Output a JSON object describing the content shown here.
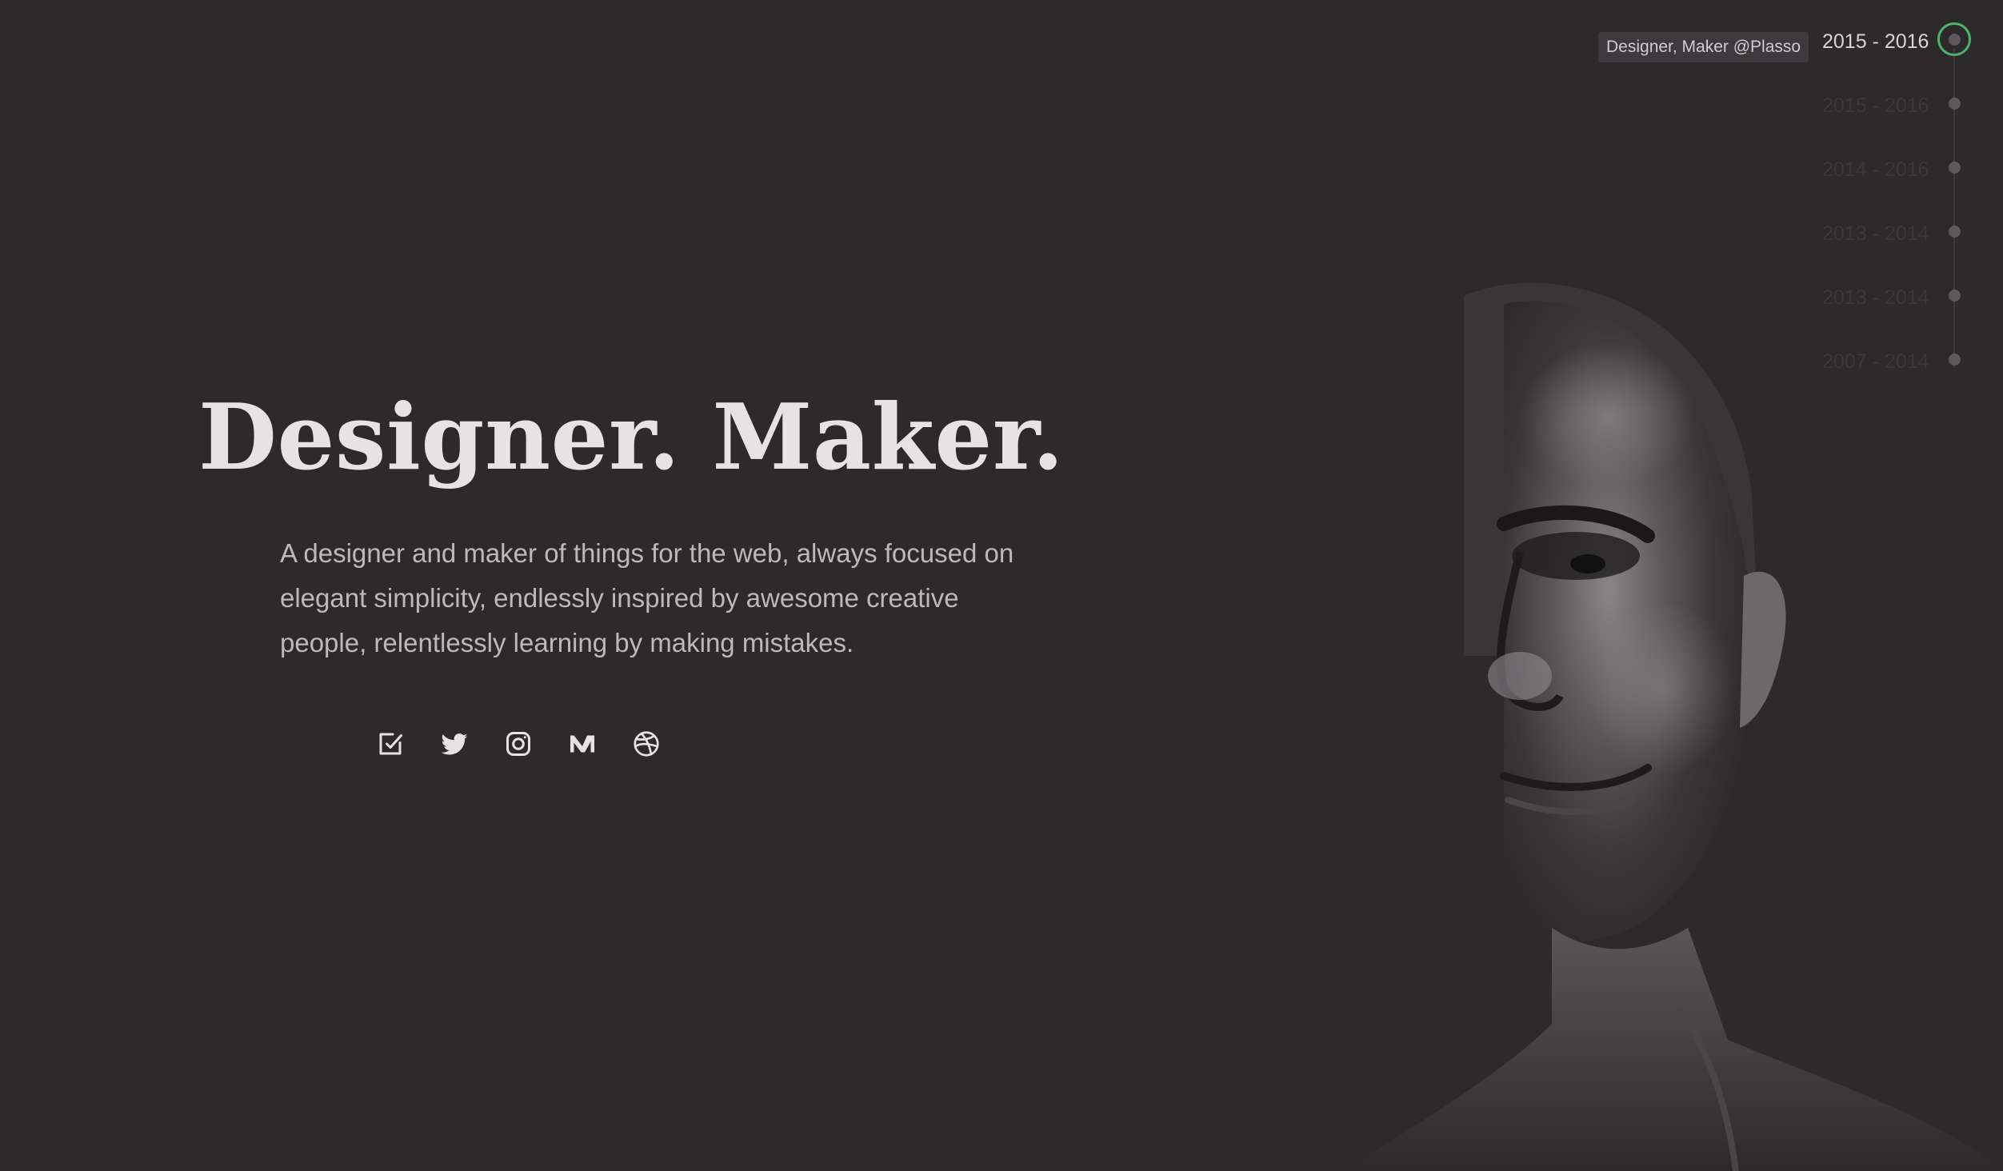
{
  "hero": {
    "headline": "Designer. Maker.",
    "intro": "A designer and maker of things for the web, always focused on elegant simplicity, endlessly inspired by awesome creative people, relentlessly learning by making mistakes."
  },
  "social": [
    {
      "icon": "blog-icon"
    },
    {
      "icon": "twitter-icon"
    },
    {
      "icon": "instagram-icon"
    },
    {
      "icon": "medium-icon"
    },
    {
      "icon": "dribbble-icon"
    }
  ],
  "timeline": {
    "active_badge": "Designer, Maker @Plasso",
    "items": [
      {
        "label": "2015 - 2016",
        "active": true
      },
      {
        "label": "2015 - 2016",
        "active": false
      },
      {
        "label": "2014 - 2016",
        "active": false
      },
      {
        "label": "2013 - 2014",
        "active": false
      },
      {
        "label": "2013 - 2014",
        "active": false
      },
      {
        "label": "2007 - 2014",
        "active": false
      }
    ]
  },
  "colors": {
    "background": "#2d2a2c",
    "headline": "#e6e3e4",
    "body_text": "#bdb8bb",
    "accent": "#4db467"
  }
}
